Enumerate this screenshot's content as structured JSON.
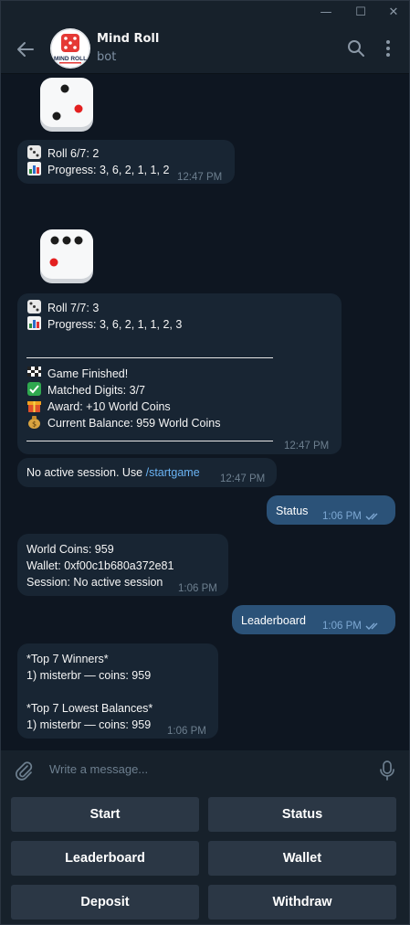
{
  "window": {
    "minimize_glyph": "—",
    "maximize_glyph": "☐",
    "close_glyph": "✕"
  },
  "header": {
    "title": "Mind Roll",
    "subtitle": "bot",
    "avatar_text": "MIND ROLL"
  },
  "messages": {
    "roll6": {
      "roll_text": "Roll 6/7: 2",
      "progress_text": "Progress: 3, 6, 2, 1, 1, 2",
      "time": "12:47 PM"
    },
    "roll7": {
      "roll_text": "Roll 7/7: 3",
      "progress_text": "Progress: 3, 6, 2, 1, 1, 2, 3",
      "finished_text": "Game Finished!",
      "matched_text": "Matched Digits: 3/7",
      "award_text": "Award: +10 World Coins",
      "balance_text": "Current Balance: 959 World Coins",
      "time": "12:47 PM"
    },
    "no_session": {
      "text": "No active session. Use ",
      "command": "/startgame",
      "time": "12:47 PM"
    },
    "status_out": {
      "text": "Status",
      "time": "1:06 PM"
    },
    "status_reply": {
      "coins": "World Coins: 959",
      "wallet": "Wallet: 0xf00c1b680a372e81",
      "session": "Session: No active session",
      "time": "1:06 PM"
    },
    "leaderboard_out": {
      "text": "Leaderboard",
      "time": "1:06 PM"
    },
    "leaderboard_reply": {
      "top_title": "*Top 7 Winners*",
      "top_1": "1) misterbr — coins: 959",
      "low_title": "*Top 7 Lowest Balances*",
      "low_1": "1) misterbr — coins: 959",
      "time": "1:06 PM"
    }
  },
  "composer": {
    "placeholder": "Write a message..."
  },
  "keyboard": {
    "start": "Start",
    "status": "Status",
    "leaderboard": "Leaderboard",
    "wallet": "Wallet",
    "deposit": "Deposit",
    "withdraw": "Withdraw"
  },
  "colors": {
    "background": "#0e1621",
    "incoming_bubble": "#182533",
    "outgoing_bubble": "#2b5278",
    "link": "#6ab3f3",
    "keyboard_button": "#2b3745"
  },
  "icons": [
    "back-arrow-icon",
    "search-icon",
    "more-vertical-icon",
    "dice-icon",
    "chart-icon",
    "checkered-flag-icon",
    "check-mark-icon",
    "gift-icon",
    "money-bag-icon",
    "double-check-icon",
    "paperclip-icon",
    "microphone-icon"
  ]
}
